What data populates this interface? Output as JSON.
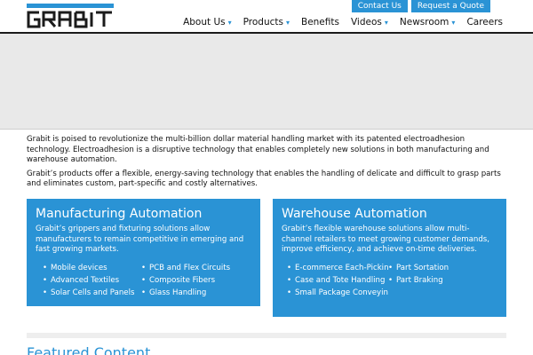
{
  "header": {
    "logo_icon": "grabit-logo",
    "top_links": [
      "Contact Us",
      "Request a Quote"
    ],
    "nav": [
      {
        "label": "About Us",
        "has_dropdown": true
      },
      {
        "label": "Products",
        "has_dropdown": true
      },
      {
        "label": "Benefits",
        "has_dropdown": false
      },
      {
        "label": "Videos",
        "has_dropdown": true
      },
      {
        "label": "Newsroom",
        "has_dropdown": true
      },
      {
        "label": "Careers",
        "has_dropdown": false
      }
    ],
    "caret": "▾"
  },
  "intro": {
    "p1": "Grabit is poised to revolutionize the multi-billion dollar material handling market with its patented electroadhesion technology. Electroadhesion is a disruptive technology that enables completely new solutions in both manufacturing and warehouse automation.",
    "p2": "Grabit’s products offer a flexible, energy-saving technology that enables the handling of delicate and difficult to grasp parts and eliminates custom, part-specific and costly alternatives."
  },
  "cards": {
    "manufacturing": {
      "title": "Manufacturing Automation",
      "desc": "Grabit’s grippers and fixturing solutions allow manufacturers to remain competitive in emerging and fast growing markets.",
      "col1": [
        "Mobile devices",
        "Advanced Textiles",
        "Solar Cells and Panels"
      ],
      "col2": [
        "PCB and Flex Circuits",
        "Composite Fibers",
        "Glass Handling"
      ]
    },
    "warehouse": {
      "title": "Warehouse Automation",
      "desc": "Grabit’s flexible warehouse solutions allow multi-channel retailers to meet growing customer demands, improve efficiency, and achieve on-time deliveries.",
      "col1": [
        "E-commerce Each-Picking",
        "Case and Tote Handling",
        "Small Package Conveying"
      ],
      "col2": [
        "Part Sortation",
        "Part Braking"
      ]
    }
  },
  "featured": {
    "title": "Featured Content"
  },
  "colors": {
    "accent": "#2a93d5",
    "dark": "#1b1b1b",
    "banner": "#e9e9e9"
  }
}
